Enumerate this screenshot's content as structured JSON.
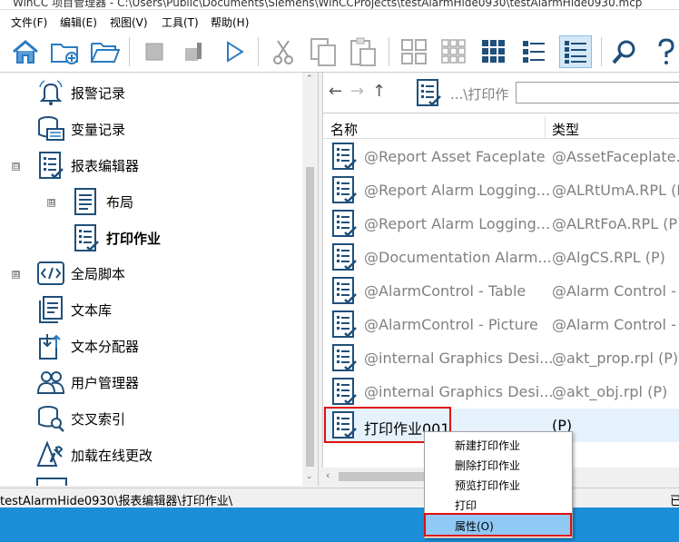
{
  "window": {
    "title": "WinCC 项目管理器 - C:\\Users\\Public\\Documents\\Siemens\\WinCCProjects\\testAlarmHide0930\\testAlarmHide0930.mcp"
  },
  "menu": [
    "文件(F)",
    "编辑(E)",
    "视图(V)",
    "工具(T)",
    "帮助(H)"
  ],
  "toolbar": {
    "icons": [
      "home-icon",
      "new-folder-icon",
      "open-folder-icon",
      "stop-icon",
      "tools-icon",
      "play-icon",
      "cut-icon",
      "copy-icon",
      "paste-icon",
      "large-icons-icon",
      "small-icons-icon",
      "grid-icon",
      "list-icon",
      "details-icon",
      "search-icon",
      "help-icon"
    ]
  },
  "tree": [
    {
      "label": "报警记录",
      "icon": "bell-icon"
    },
    {
      "label": "变量记录",
      "icon": "database-icon"
    },
    {
      "label": "报表编辑器",
      "icon": "report-icon",
      "expander": "⊟"
    },
    {
      "label": "布局",
      "icon": "layout-icon",
      "expander": "⊞"
    },
    {
      "label": "打印作业",
      "icon": "print-job-icon"
    },
    {
      "label": "全局脚本",
      "icon": "script-icon",
      "expander": "⊞"
    },
    {
      "label": "文本库",
      "icon": "text-library-icon"
    },
    {
      "label": "文本分配器",
      "icon": "text-distributor-icon"
    },
    {
      "label": "用户管理器",
      "icon": "user-manager-icon"
    },
    {
      "label": "交叉索引",
      "icon": "cross-reference-icon"
    },
    {
      "label": "加载在线更改",
      "icon": "load-online-changes-icon"
    }
  ],
  "address": {
    "path": "...\\打印作"
  },
  "columns": {
    "name": "名称",
    "type": "类型"
  },
  "rows": [
    {
      "name": "@Report Asset Faceplate",
      "type": "@AssetFaceplate.r"
    },
    {
      "name": "@Report Alarm Logging...",
      "type": "@ALRtUmA.RPL (P"
    },
    {
      "name": "@Report Alarm Logging...",
      "type": "@ALRtFoA.RPL (P)"
    },
    {
      "name": "@Documentation Alarm...",
      "type": "@AlgCS.RPL (P)"
    },
    {
      "name": "@AlarmControl - Table",
      "type": "@Alarm Control -"
    },
    {
      "name": "@AlarmControl - Picture",
      "type": "@Alarm Control -"
    },
    {
      "name": "@internal Graphics Desi...",
      "type": "@akt_prop.rpl (P)"
    },
    {
      "name": "@internal Graphics Desi...",
      "type": "@akt_obj.rpl (P)"
    },
    {
      "name": "打印作业001",
      "type": "(P)"
    }
  ],
  "context_menu": [
    "新建打印作业",
    "删除打印作业",
    "预览打印作业",
    "打印",
    "属性(O)"
  ],
  "status": {
    "path": "testAlarmHide0930\\报表编辑器\\打印作业\\",
    "right": "已"
  }
}
